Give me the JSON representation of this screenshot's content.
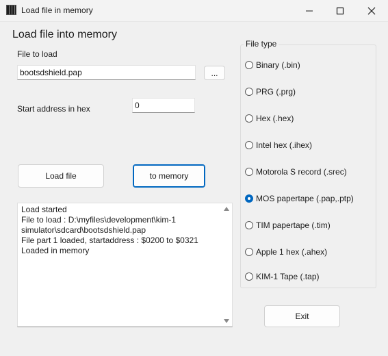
{
  "window": {
    "title": "Load file in memory"
  },
  "heading": "Load file into memory",
  "file_to_load": {
    "label": "File to load",
    "value": "bootsdshield.pap",
    "browse_label": "..."
  },
  "start_address": {
    "label": "Start address in hex",
    "value": "0"
  },
  "buttons": {
    "load_file": "Load file",
    "to_memory": "to memory",
    "exit": "Exit"
  },
  "log": {
    "lines": [
      "Load started",
      "File to load : D:\\myfiles\\development\\kim-1",
      "simulator\\sdcard\\bootsdshield.pap",
      "File part 1 loaded, startaddress : $0200 to $0321",
      "Loaded in memory"
    ]
  },
  "file_type": {
    "label": "File type",
    "selected_index": 5,
    "options": [
      "Binary (.bin)",
      "PRG (.prg)",
      "Hex (.hex)",
      "Intel hex (.ihex)",
      "Motorola S record (.srec)",
      "MOS papertape (.pap,.ptp)",
      "TIM papertape (.tim)",
      "Apple 1 hex (.ahex)",
      "KIM-1 Tape (.tap)"
    ]
  },
  "colors": {
    "accent": "#0067c0",
    "background": "#f0f0f0"
  }
}
